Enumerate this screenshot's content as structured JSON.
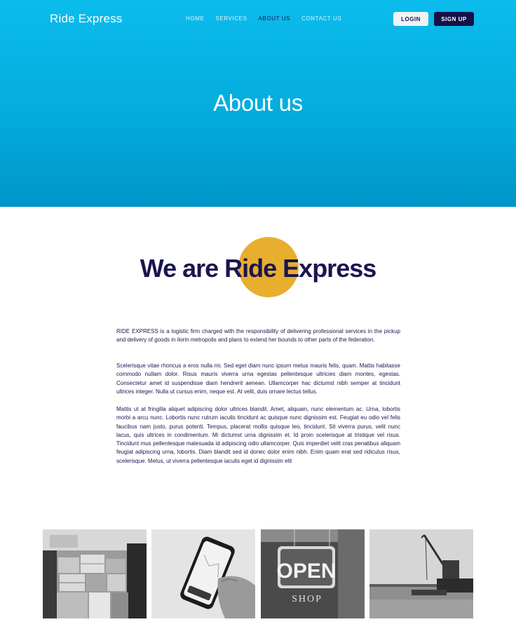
{
  "brand": {
    "name": "Ride Express"
  },
  "nav": {
    "items": [
      {
        "label": "HOME",
        "active": false
      },
      {
        "label": "SERVICES",
        "active": false
      },
      {
        "label": "ABOUT US",
        "active": true
      },
      {
        "label": "CONTACT US",
        "active": false
      }
    ],
    "login_label": "LOGIN",
    "signup_label": "SIGN UP"
  },
  "hero": {
    "title": "About us"
  },
  "intro": {
    "headline": "We are Ride Express",
    "paragraphs": [
      "RIDE EXPRESS is a logistic firm charged with the  responsibility of delivering professional services in the pickup and delivery of goods in ilorin metropolis  and plans to extend her bounds to other parts of the federation.",
      "Scelerisque vitae rhoncus a eros nulla mi. Sed eget diam nunc ipsum metus mauris felis, quam. Mattis habitasse commodo nullam dolor. Risus mauris viverra urna egestas pellentesque ultricies diam montes, egestas. Consectetur amet id suspendisse diam hendrerit aenean. Ullamcorper hac dictumst nibh semper at tincidunt ultrices integer. Nulla ut cursus enim, neque est. At velit, duis ornare lectus tellus.",
      "Mattis ut at fringilla aliquet adipiscing dolor ultrices blandit. Amet, aliquam, nunc elementum ac. Urna, lobortis morbi a arcu nunc. Lobortis nunc rutrum iaculis tincidunt ac quisque nunc dignissim est. Feugiat eu odio vel felis faucibus nam justo, purus potenti. Tempus, placerat mollis quisque leo, tincidunt. Sit viverra purus, velit nunc lacus, quis ultrices in condimentum. Mi dictumst urna dignissim et. Id proin scelerisque at tristique vel risus. Tincidunt mus pellentesque malesuada id adipiscing odio ullamcorper. Quis imperdiet velit cras penatibus aliquam feugiat adipiscing urna, lobortis. Diam blandit sed id donec dolor enim nibh. Enim quam erat sed ridiculus risus, scelerisque. Metus, ut viverra pellentesque iaculis eget id dignissim elit"
    ]
  },
  "gallery": {
    "photos": [
      {
        "subject": "warehouse-boxes"
      },
      {
        "subject": "phone-in-hand"
      },
      {
        "subject": "open-shop-sign",
        "sign_text": "OPEN",
        "sign_subtext": "SHOP"
      },
      {
        "subject": "cargo-ship-crane"
      }
    ]
  },
  "colors": {
    "hero_blue": "#0bbcec",
    "navy": "#1a1550",
    "accent_yellow": "#e8ae2e",
    "signup_bg": "#14114a"
  }
}
